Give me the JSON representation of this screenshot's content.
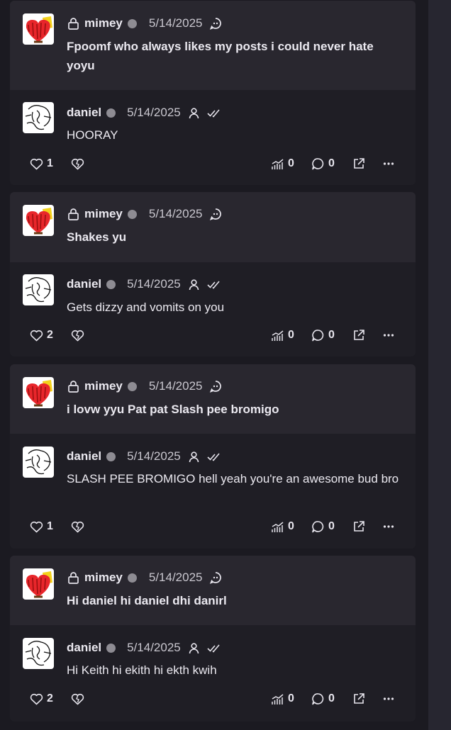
{
  "threads": [
    {
      "quote": {
        "username": "mimey",
        "date": "5/14/2025",
        "text": "Fpoomf who always likes my posts i could never hate yoyu"
      },
      "reply": {
        "username": "daniel",
        "date": "5/14/2025",
        "text": "HOORAY"
      },
      "stats": {
        "likes": "1",
        "views": "0",
        "comments": "0"
      }
    },
    {
      "quote": {
        "username": "mimey",
        "date": "5/14/2025",
        "text": "Shakes yu"
      },
      "reply": {
        "username": "daniel",
        "date": "5/14/2025",
        "text": "Gets dizzy and vomits on you"
      },
      "stats": {
        "likes": "2",
        "views": "0",
        "comments": "0"
      }
    },
    {
      "quote": {
        "username": "mimey",
        "date": "5/14/2025",
        "text": "i lovw yyu Pat pat Slash pee bromigo"
      },
      "reply": {
        "username": "daniel",
        "date": "5/14/2025",
        "text": "SLASH PEE BROMIGO hell yeah you're an awesome bud bro"
      },
      "stats": {
        "likes": "1",
        "views": "0",
        "comments": "0"
      }
    },
    {
      "quote": {
        "username": "mimey",
        "date": "5/14/2025",
        "text": "Hi daniel hi daniel dhi danirl"
      },
      "reply": {
        "username": "daniel",
        "date": "5/14/2025",
        "text": "Hi Keith hi ekith hi ekth kwih"
      },
      "stats": {
        "likes": "2",
        "views": "0",
        "comments": "0"
      }
    }
  ],
  "icons": {
    "lock": "lock-icon",
    "quote": "quote-bubble-icon",
    "user": "user-icon",
    "read": "double-check-icon",
    "like": "heart-icon",
    "dislike": "broken-heart-icon",
    "views": "views-chart-icon",
    "comment": "comment-icon",
    "share": "share-icon",
    "more": "more-icon"
  },
  "colors": {
    "background": "#1b1a21",
    "card": "#1f1e25",
    "quote": "#29272f",
    "text": "#ebe9f0",
    "status_dot": "#8e8c93"
  }
}
